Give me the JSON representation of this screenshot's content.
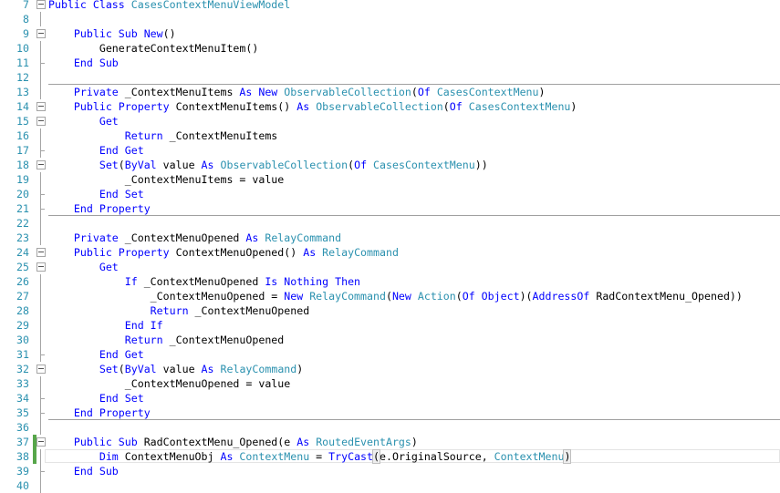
{
  "editor": {
    "lines": [
      {
        "n": "7",
        "fold": "open",
        "tokens": [
          {
            "t": "Public Class ",
            "c": "kw"
          },
          {
            "t": "CasesContextMenuViewModel",
            "c": "ty"
          }
        ]
      },
      {
        "n": "8",
        "tokens": []
      },
      {
        "n": "9",
        "fold": "open",
        "tokens": [
          {
            "t": "    Public Sub ",
            "c": "kw"
          },
          {
            "t": "New",
            "c": "kw"
          },
          {
            "t": "()",
            "c": "tx"
          }
        ]
      },
      {
        "n": "10",
        "tokens": [
          {
            "t": "        GenerateContextMenuItem()",
            "c": "tx"
          }
        ]
      },
      {
        "n": "11",
        "foldEnd": true,
        "tokens": [
          {
            "t": "    End Sub",
            "c": "kw"
          }
        ]
      },
      {
        "n": "12",
        "sep": true,
        "tokens": []
      },
      {
        "n": "13",
        "tokens": [
          {
            "t": "    Private ",
            "c": "kw"
          },
          {
            "t": "_ContextMenuItems ",
            "c": "tx"
          },
          {
            "t": "As New ",
            "c": "kw"
          },
          {
            "t": "ObservableCollection",
            "c": "ty"
          },
          {
            "t": "(",
            "c": "tx"
          },
          {
            "t": "Of ",
            "c": "kw"
          },
          {
            "t": "CasesContextMenu",
            "c": "ty"
          },
          {
            "t": ")",
            "c": "tx"
          }
        ]
      },
      {
        "n": "14",
        "fold": "open",
        "tokens": [
          {
            "t": "    Public Property ",
            "c": "kw"
          },
          {
            "t": "ContextMenuItems() ",
            "c": "tx"
          },
          {
            "t": "As ",
            "c": "kw"
          },
          {
            "t": "ObservableCollection",
            "c": "ty"
          },
          {
            "t": "(",
            "c": "tx"
          },
          {
            "t": "Of ",
            "c": "kw"
          },
          {
            "t": "CasesContextMenu",
            "c": "ty"
          },
          {
            "t": ")",
            "c": "tx"
          }
        ]
      },
      {
        "n": "15",
        "fold": "open",
        "tokens": [
          {
            "t": "        Get",
            "c": "kw"
          }
        ]
      },
      {
        "n": "16",
        "tokens": [
          {
            "t": "            Return ",
            "c": "kw"
          },
          {
            "t": "_ContextMenuItems",
            "c": "tx"
          }
        ]
      },
      {
        "n": "17",
        "foldEnd": true,
        "tokens": [
          {
            "t": "        End Get",
            "c": "kw"
          }
        ]
      },
      {
        "n": "18",
        "fold": "open",
        "tokens": [
          {
            "t": "        Set",
            "c": "kw"
          },
          {
            "t": "(",
            "c": "tx"
          },
          {
            "t": "ByVal ",
            "c": "kw"
          },
          {
            "t": "value ",
            "c": "tx"
          },
          {
            "t": "As ",
            "c": "kw"
          },
          {
            "t": "ObservableCollection",
            "c": "ty"
          },
          {
            "t": "(",
            "c": "tx"
          },
          {
            "t": "Of ",
            "c": "kw"
          },
          {
            "t": "CasesContextMenu",
            "c": "ty"
          },
          {
            "t": "))",
            "c": "tx"
          }
        ]
      },
      {
        "n": "19",
        "tokens": [
          {
            "t": "            _ContextMenuItems = value",
            "c": "tx"
          }
        ]
      },
      {
        "n": "20",
        "foldEnd": true,
        "tokens": [
          {
            "t": "        End Set",
            "c": "kw"
          }
        ]
      },
      {
        "n": "21",
        "foldEnd": true,
        "sep": true,
        "tokens": [
          {
            "t": "    End Property",
            "c": "kw"
          }
        ]
      },
      {
        "n": "22",
        "tokens": []
      },
      {
        "n": "23",
        "tokens": [
          {
            "t": "    Private ",
            "c": "kw"
          },
          {
            "t": "_ContextMenuOpened ",
            "c": "tx"
          },
          {
            "t": "As ",
            "c": "kw"
          },
          {
            "t": "RelayCommand",
            "c": "ty"
          }
        ]
      },
      {
        "n": "24",
        "fold": "open",
        "tokens": [
          {
            "t": "    Public Property ",
            "c": "kw"
          },
          {
            "t": "ContextMenuOpened() ",
            "c": "tx"
          },
          {
            "t": "As ",
            "c": "kw"
          },
          {
            "t": "RelayCommand",
            "c": "ty"
          }
        ]
      },
      {
        "n": "25",
        "fold": "open",
        "tokens": [
          {
            "t": "        Get",
            "c": "kw"
          }
        ]
      },
      {
        "n": "26",
        "tokens": [
          {
            "t": "            If ",
            "c": "kw"
          },
          {
            "t": "_ContextMenuOpened ",
            "c": "tx"
          },
          {
            "t": "Is Nothing Then",
            "c": "kw"
          }
        ]
      },
      {
        "n": "27",
        "tokens": [
          {
            "t": "                _ContextMenuOpened = ",
            "c": "tx"
          },
          {
            "t": "New ",
            "c": "kw"
          },
          {
            "t": "RelayCommand",
            "c": "ty"
          },
          {
            "t": "(",
            "c": "tx"
          },
          {
            "t": "New ",
            "c": "kw"
          },
          {
            "t": "Action",
            "c": "ty"
          },
          {
            "t": "(",
            "c": "tx"
          },
          {
            "t": "Of Object",
            "c": "kw"
          },
          {
            "t": ")(",
            "c": "tx"
          },
          {
            "t": "AddressOf ",
            "c": "kw"
          },
          {
            "t": "RadContextMenu_Opened))",
            "c": "tx"
          }
        ]
      },
      {
        "n": "28",
        "tokens": [
          {
            "t": "                Return ",
            "c": "kw"
          },
          {
            "t": "_ContextMenuOpened",
            "c": "tx"
          }
        ]
      },
      {
        "n": "29",
        "tokens": [
          {
            "t": "            End If",
            "c": "kw"
          }
        ]
      },
      {
        "n": "30",
        "tokens": [
          {
            "t": "            Return ",
            "c": "kw"
          },
          {
            "t": "_ContextMenuOpened",
            "c": "tx"
          }
        ]
      },
      {
        "n": "31",
        "foldEnd": true,
        "tokens": [
          {
            "t": "        End Get",
            "c": "kw"
          }
        ]
      },
      {
        "n": "32",
        "fold": "open",
        "tokens": [
          {
            "t": "        Set",
            "c": "kw"
          },
          {
            "t": "(",
            "c": "tx"
          },
          {
            "t": "ByVal ",
            "c": "kw"
          },
          {
            "t": "value ",
            "c": "tx"
          },
          {
            "t": "As ",
            "c": "kw"
          },
          {
            "t": "RelayCommand",
            "c": "ty"
          },
          {
            "t": ")",
            "c": "tx"
          }
        ]
      },
      {
        "n": "33",
        "tokens": [
          {
            "t": "            _ContextMenuOpened = value",
            "c": "tx"
          }
        ]
      },
      {
        "n": "34",
        "foldEnd": true,
        "tokens": [
          {
            "t": "        End Set",
            "c": "kw"
          }
        ]
      },
      {
        "n": "35",
        "foldEnd": true,
        "sep": true,
        "tokens": [
          {
            "t": "    End Property",
            "c": "kw"
          }
        ]
      },
      {
        "n": "36",
        "tokens": []
      },
      {
        "n": "37",
        "fold": "open",
        "changed": true,
        "tokens": [
          {
            "t": "    Public Sub ",
            "c": "kw"
          },
          {
            "t": "RadContextMenu_Opened(e ",
            "c": "tx"
          },
          {
            "t": "As ",
            "c": "kw"
          },
          {
            "t": "RoutedEventArgs",
            "c": "ty"
          },
          {
            "t": ")",
            "c": "tx"
          }
        ]
      },
      {
        "n": "38",
        "changed": true,
        "current": true,
        "tokens": [
          {
            "t": "        Dim ",
            "c": "kw"
          },
          {
            "t": "ContextMenuObj ",
            "c": "tx"
          },
          {
            "t": "As ",
            "c": "kw"
          },
          {
            "t": "ContextMenu",
            "c": "ty"
          },
          {
            "t": " = ",
            "c": "tx"
          },
          {
            "t": "TryCast",
            "c": "kw"
          },
          {
            "t": "(",
            "c": "tx br"
          },
          {
            "t": "e.OriginalSource, ",
            "c": "tx"
          },
          {
            "t": "ContextMenu",
            "c": "ty"
          },
          {
            "t": ")",
            "c": "tx br"
          }
        ]
      },
      {
        "n": "39",
        "foldEnd": true,
        "tokens": [
          {
            "t": "    End Sub",
            "c": "kw"
          }
        ]
      },
      {
        "n": "40",
        "tokens": []
      }
    ]
  }
}
